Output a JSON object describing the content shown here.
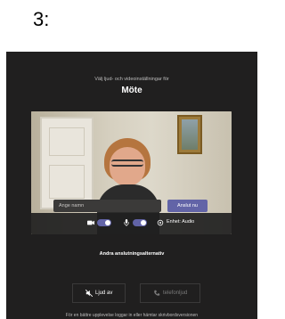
{
  "step": {
    "label": "3:"
  },
  "header": {
    "subtitle": "Välj ljud- och videoinställningar för",
    "title": "Möte"
  },
  "join": {
    "name_placeholder": "Ange namn",
    "join_button": "Anslut nu"
  },
  "controls": {
    "camera_on": true,
    "mic_on": true,
    "device_settings_label": "Enhet: Audio"
  },
  "other_options": {
    "title": "Andra anslutningsalternativ",
    "audio_off": "Ljud av",
    "phone_audio": "telefonljud"
  },
  "footer": {
    "text": "För en bättre upplevelse loggar in eller hämtar skrivbordsversionen"
  },
  "colors": {
    "accent": "#6264a7",
    "background": "#201f1f"
  }
}
